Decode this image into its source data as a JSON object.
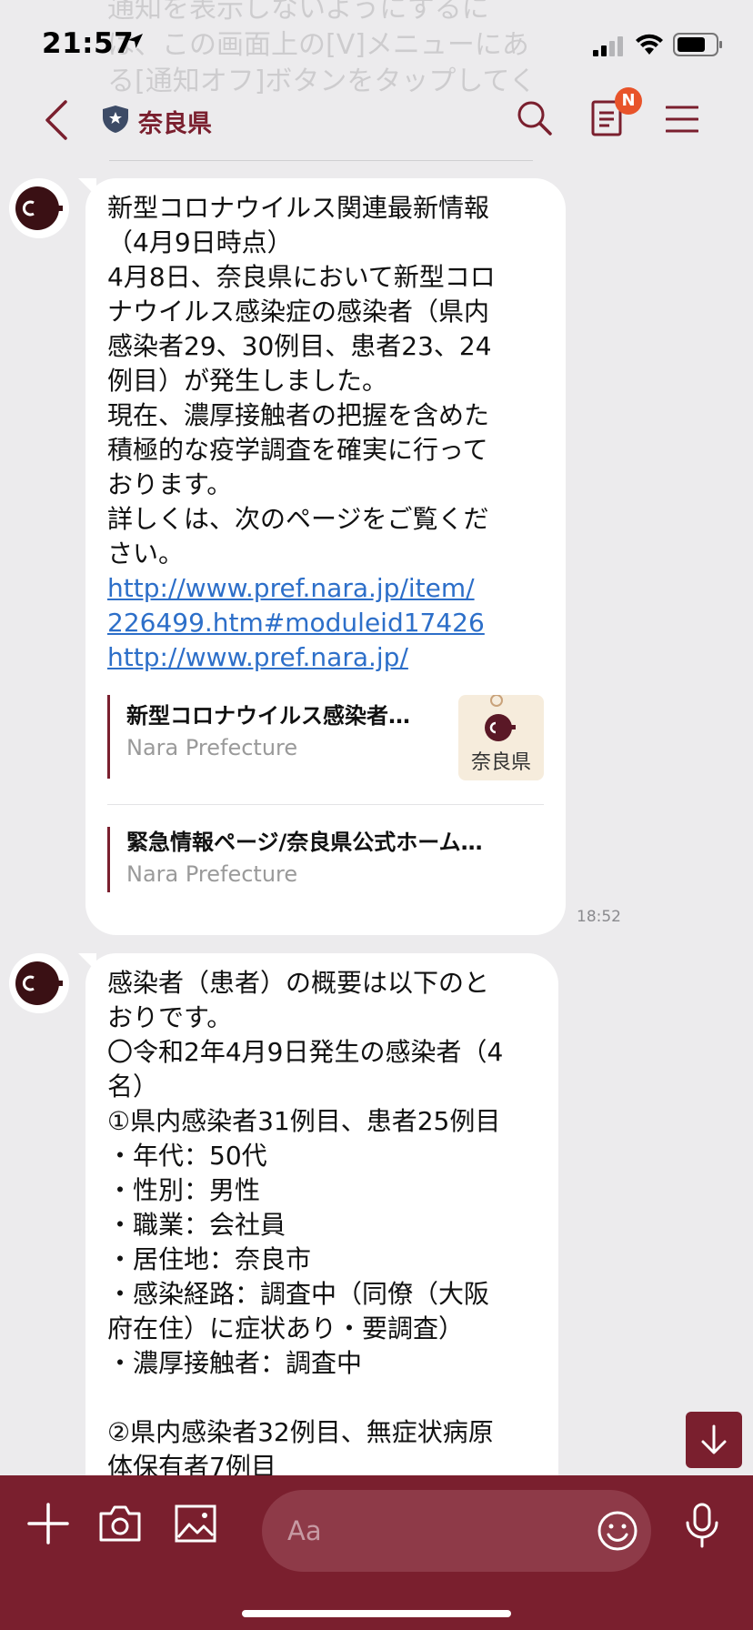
{
  "status_bar": {
    "time": "21:57"
  },
  "header": {
    "ghost_text": "通知を表示しないようにするに\nは、この画面上の[V]メニューにあ\nる[通知オフ]ボタンをタップしてく",
    "title": "奈良県",
    "notes_badge": "N"
  },
  "messages": [
    {
      "text": "新型コロナウイルス関連最新情報\n（4月9日時点）\n4月8日、奈良県において新型コロ\nナウイルス感染症の感染者（県内\n感染者29、30例目、患者23、24\n例目）が発生しました。\n現在、濃厚接触者の把握を含めた\n積極的な疫学調査を確実に行って\nおります。\n詳しくは、次のページをご覧くだ\nさい。",
      "link1": "http://www.pref.nara.jp/item/\n226499.htm#moduleid17426",
      "link2": "http://www.pref.nara.jp/",
      "cards": [
        {
          "title": "新型コロナウイルス感染者…",
          "source": "Nara Prefecture",
          "thumb_text": "奈良県"
        },
        {
          "title": "緊急情報ページ/奈良県公式ホーム…",
          "source": "Nara Prefecture"
        }
      ],
      "timestamp": "18:52"
    },
    {
      "text": "感染者（患者）の概要は以下のと\nおりです。\n〇令和2年4月9日発生の感染者（4\n名）\n①県内感染者31例目、患者25例目\n・年代：50代\n・性別：男性\n・職業：会社員\n・居住地：奈良市\n・感染経路：調査中（同僚（大阪\n府在住）に症状あり・要調査）\n・濃厚接触者：調査中\n\n②県内感染者32例目、無症状病原\n体保有者7例目"
    }
  ],
  "composer": {
    "placeholder": "Aa"
  },
  "colors": {
    "brand": "#7a1f2e",
    "link": "#2d6fc9",
    "badge": "#e8532a"
  }
}
